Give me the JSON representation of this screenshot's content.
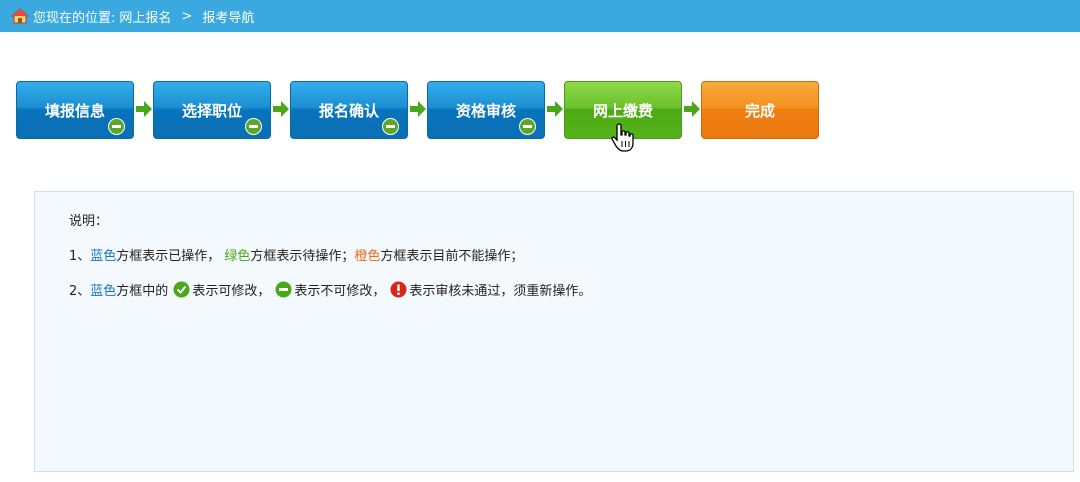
{
  "breadcrumb": {
    "prefix": "您现在的位置:",
    "items": [
      "网上报名",
      "报考导航"
    ],
    "separator": ">"
  },
  "steps": [
    {
      "label": "填报信息",
      "state": "done",
      "color": "#1b8fd2",
      "badge": "minus-icon"
    },
    {
      "label": "选择职位",
      "state": "done",
      "color": "#1b8fd2",
      "badge": "minus-icon"
    },
    {
      "label": "报名确认",
      "state": "done",
      "color": "#1b8fd2",
      "badge": "minus-icon"
    },
    {
      "label": "资格审核",
      "state": "done",
      "color": "#1b8fd2",
      "badge": "minus-icon"
    },
    {
      "label": "网上缴费",
      "state": "pending",
      "color": "#6cc22c"
    },
    {
      "label": "完成",
      "state": "unavailable",
      "color": "#f39321"
    }
  ],
  "notes": {
    "title": "说明：",
    "line1": {
      "num": "1、",
      "blue": "蓝色",
      "t1": "方框表示已操作，",
      "green": "绿色",
      "t2": "方框表示待操作；",
      "orange": "橙色",
      "t3": "方框表示目前不能操作；"
    },
    "line2": {
      "num": "2、",
      "blue": "蓝色",
      "t1": "方框中的",
      "t2": "表示可修改，",
      "t3": "表示不可修改，",
      "t4": "表示审核未通过，须重新操作。"
    }
  },
  "colors": {
    "header": "#3aa9df",
    "blue_text": "#1a73c7",
    "green_text": "#4aa818",
    "orange_text": "#ee6a1a"
  }
}
